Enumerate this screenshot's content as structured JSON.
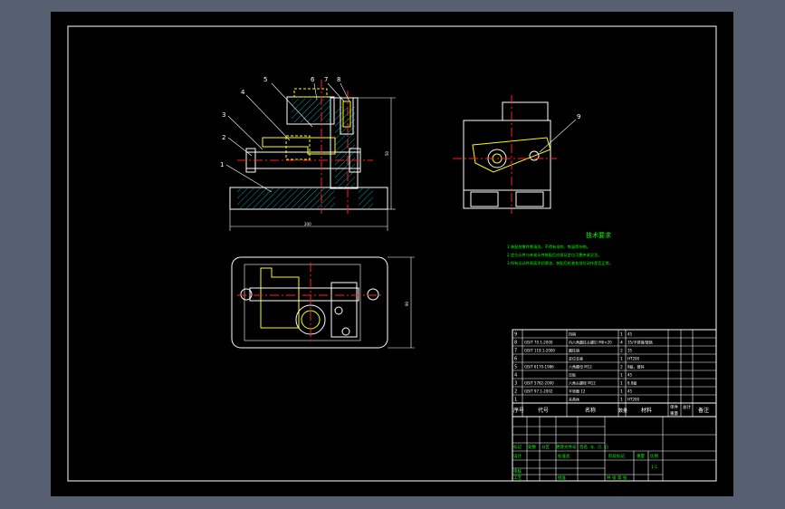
{
  "drawing": {
    "background": "#000000",
    "frame_color": "#ffffff",
    "outline_color": "#ffffff",
    "hidden_line_color": "#ffff00",
    "center_line_color": "#ff2020",
    "hatch_color": "#00c8c8",
    "dimension_color": "#ffffff",
    "note_color": "#00ff00"
  },
  "front_view": {
    "balloons": [
      "5",
      "6",
      "7",
      "8",
      "4",
      "3",
      "2",
      "1"
    ],
    "dim_overall_height": "50",
    "dim_overall_width": "200"
  },
  "side_view": {
    "balloons": [
      "9"
    ]
  },
  "top_view": {
    "dim_overall_depth": "90"
  },
  "technical_requirements": {
    "title": "技术要求",
    "lines": [
      "1.装配前零件需清洗，不得有毛刺、铁屑等杂物。",
      "2.定位元件与夹紧元件装配后应保证定位可靠夹紧灵活。",
      "3.所有运动件表面涂润滑油，装配后检查各部位动作是否正常。"
    ]
  },
  "bom": {
    "rows": [
      {
        "no": "9",
        "code": "",
        "name": "挡销",
        "qty": "1",
        "material": "45"
      },
      {
        "no": "8",
        "code": "GB/T 70.1-2000",
        "name": "内六角圆柱头螺钉 M6×20",
        "qty": "4",
        "material": "35/不锈钢/镀铬"
      },
      {
        "no": "7",
        "code": "GB/T 119.1-2000",
        "name": "圆柱销",
        "qty": "2",
        "material": "35"
      },
      {
        "no": "6",
        "code": "",
        "name": "定位支座",
        "qty": "1",
        "material": "HT200"
      },
      {
        "no": "5",
        "code": "GB/T 6170-1986",
        "name": "六角螺母 M12",
        "qty": "2",
        "material": "8级，镀锌"
      },
      {
        "no": "4",
        "code": "",
        "name": "压板",
        "qty": "1",
        "material": "45"
      },
      {
        "no": "3",
        "code": "GB/T 5782-2000",
        "name": "六角头螺栓 M12",
        "qty": "1",
        "material": "8.8级"
      },
      {
        "no": "2",
        "code": "GB/T 97.1-2002",
        "name": "平垫圈 12",
        "qty": "1",
        "material": "45"
      },
      {
        "no": "1",
        "code": "",
        "name": "夹具体",
        "qty": "1",
        "material": "HT200"
      }
    ],
    "header": {
      "no": "序号",
      "code": "代号",
      "name": "名称",
      "qty": "数量",
      "material": "材料",
      "unit_weight": "单件",
      "total_weight": "总计",
      "weight": "重量",
      "remark": "备注"
    }
  },
  "title_block": {
    "marks": "标记",
    "count": "处数",
    "zone": "分区",
    "change_doc": "更改文件号",
    "signature": "签名",
    "date": "年、月、日",
    "designer": "设计",
    "standardize": "标准化",
    "stage_mark": "阶段标记",
    "weight": "重量",
    "scale": "比例",
    "scale_value": "1:1",
    "review": "审核",
    "process": "工艺",
    "approve": "批准",
    "sheet": "共  张  第  张"
  }
}
